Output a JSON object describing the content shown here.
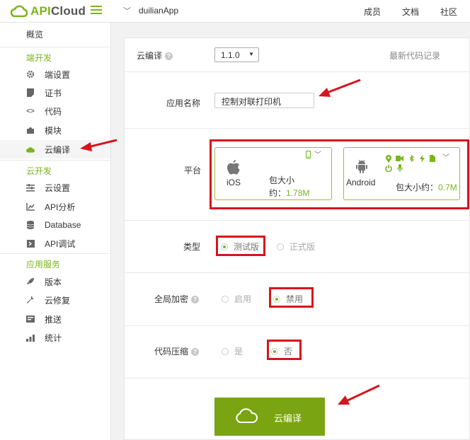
{
  "header": {
    "logo_api": "API",
    "logo_cloud": "Cloud",
    "app_name": "duilianApp",
    "links": [
      "成员",
      "文档",
      "社区"
    ]
  },
  "sidebar": {
    "overview": "概览",
    "sections": [
      {
        "title": "端开发",
        "items": [
          {
            "label": "端设置",
            "icon": "gear-icon"
          },
          {
            "label": "证书",
            "icon": "certificate-icon"
          },
          {
            "label": "代码",
            "icon": "code-icon"
          },
          {
            "label": "模块",
            "icon": "puzzle-icon"
          },
          {
            "label": "云编译",
            "icon": "cloud-icon",
            "active": true
          }
        ]
      },
      {
        "title": "云开发",
        "items": [
          {
            "label": "云设置",
            "icon": "sliders-icon"
          },
          {
            "label": "API分析",
            "icon": "chart-icon"
          },
          {
            "label": "Database",
            "icon": "database-icon"
          },
          {
            "label": "API调试",
            "icon": "debug-icon"
          }
        ]
      },
      {
        "title": "应用服务",
        "items": [
          {
            "label": "版本",
            "icon": "rocket-icon"
          },
          {
            "label": "云修复",
            "icon": "wrench-icon"
          },
          {
            "label": "推送",
            "icon": "push-icon"
          },
          {
            "label": "统计",
            "icon": "stats-icon"
          }
        ]
      }
    ]
  },
  "form": {
    "compile_label": "云编译",
    "version_value": "1.1.0",
    "history_link": "最新代码记录",
    "app_name_label": "应用名称",
    "app_name_value": "控制对联打印机",
    "platform_label": "平台",
    "ios": {
      "name": "iOS",
      "size_prefix": "包大小",
      "size_line2": "约：",
      "size_value": "1.78M"
    },
    "android": {
      "name": "Android",
      "size_prefix": "包大小约：",
      "size_value": "0.7M"
    },
    "type_label": "类型",
    "type_options": [
      "测试版",
      "正式版"
    ],
    "type_selected": "测试版",
    "encrypt_label": "全局加密",
    "encrypt_options": [
      "启用",
      "禁用"
    ],
    "encrypt_selected": "禁用",
    "compress_label": "代码压缩",
    "compress_options": [
      "是",
      "否"
    ],
    "compress_selected": "否",
    "submit_label": "云编译"
  },
  "colors": {
    "brand_green": "#7ab51d",
    "button_green": "#7ba412",
    "annotation_red": "#d7141b"
  }
}
